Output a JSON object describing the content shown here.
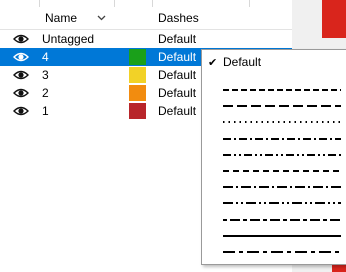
{
  "header": {
    "name_label": "Name",
    "dashes_label": "Dashes"
  },
  "rows": [
    {
      "name": "Untagged",
      "dashes": "Default",
      "color": "",
      "selected": false,
      "visible_icon": "eye-icon"
    },
    {
      "name": "4",
      "dashes": "Default",
      "color": "#1aa01a",
      "selected": true,
      "visible_icon": "eye-icon"
    },
    {
      "name": "3",
      "dashes": "Default",
      "color": "#f2d227",
      "selected": false,
      "visible_icon": "eye-icon"
    },
    {
      "name": "2",
      "dashes": "Default",
      "color": "#f28c0f",
      "selected": false,
      "visible_icon": "eye-icon"
    },
    {
      "name": "1",
      "dashes": "Default",
      "color": "#b8252a",
      "selected": false,
      "visible_icon": "eye-icon"
    }
  ],
  "dash_menu": {
    "selected_label": "Default",
    "check_glyph": "✔",
    "options": [
      {
        "name": "dash-long",
        "pattern": "6,3"
      },
      {
        "name": "dash-longer",
        "pattern": "10,4"
      },
      {
        "name": "dot",
        "pattern": "1.5,4"
      },
      {
        "name": "dash-dot",
        "pattern": "8,3,2,3"
      },
      {
        "name": "dash-dot-dot",
        "pattern": "8,3,2,3,2,3"
      },
      {
        "name": "dash-medium",
        "pattern": "6,4"
      },
      {
        "name": "dash-dot-long",
        "pattern": "10,3,2,3"
      },
      {
        "name": "dash-dot-dot-long",
        "pattern": "10,3,2,3,2,3"
      },
      {
        "name": "dash-short-long",
        "pattern": "4,3,10,3"
      },
      {
        "name": "solid",
        "pattern": "0"
      },
      {
        "name": "dash-long-short",
        "pattern": "12,4,4,4"
      }
    ]
  },
  "colors": {
    "selection": "#0078d7",
    "accent_red": "#d9251c"
  }
}
